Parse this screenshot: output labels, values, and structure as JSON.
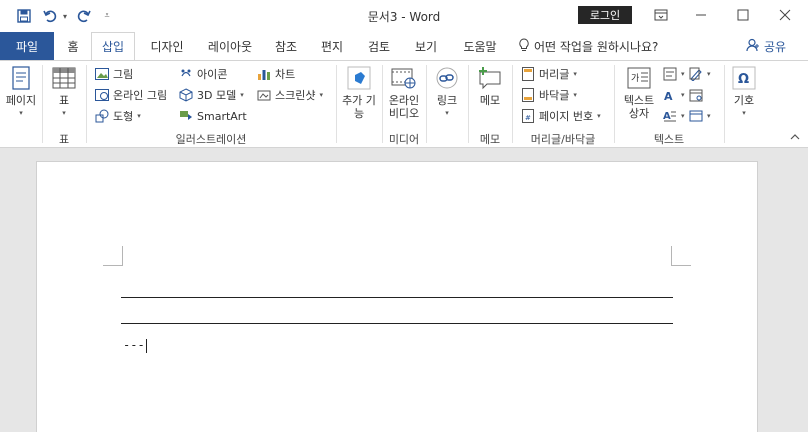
{
  "titlebar": {
    "document_title": "문서3  -  Word",
    "login_label": "로그인"
  },
  "tabs": [
    {
      "label": "파일"
    },
    {
      "label": "홈"
    },
    {
      "label": "삽입"
    },
    {
      "label": "디자인"
    },
    {
      "label": "레이아웃"
    },
    {
      "label": "참조"
    },
    {
      "label": "편지"
    },
    {
      "label": "검토"
    },
    {
      "label": "보기"
    },
    {
      "label": "도움말"
    }
  ],
  "tell_me": {
    "label": "어떤 작업을 원하시나요?"
  },
  "share": {
    "label": "공유"
  },
  "ribbon": {
    "pages": {
      "label": "페이지",
      "group": ""
    },
    "tables": {
      "label": "표",
      "group": "표"
    },
    "illustrations": {
      "group": "일러스트레이션",
      "pictures": "그림",
      "online_pictures": "온라인 그림",
      "shapes": "도형",
      "icons": "아이콘",
      "models3d": "3D 모델",
      "smartart": "SmartArt",
      "chart": "차트",
      "screenshot": "스크린샷"
    },
    "addins": {
      "line1": "추가 기",
      "line2": "능"
    },
    "media": {
      "line1": "온라인",
      "line2": "비디오",
      "group": "미디어"
    },
    "links": {
      "label": "링크"
    },
    "comments": {
      "label": "메모",
      "group": "메모"
    },
    "header_footer": {
      "group": "머리글/바닥글",
      "header": "머리글",
      "footer": "바닥글",
      "page_number": "페이지 번호"
    },
    "text": {
      "group": "텍스트",
      "textbox_line1": "텍스트",
      "textbox_line2": "상자"
    },
    "symbols": {
      "label": "기호"
    }
  },
  "document": {
    "typed_text": "---"
  },
  "colors": {
    "accent": "#2b579a",
    "login_bg": "#262626"
  }
}
